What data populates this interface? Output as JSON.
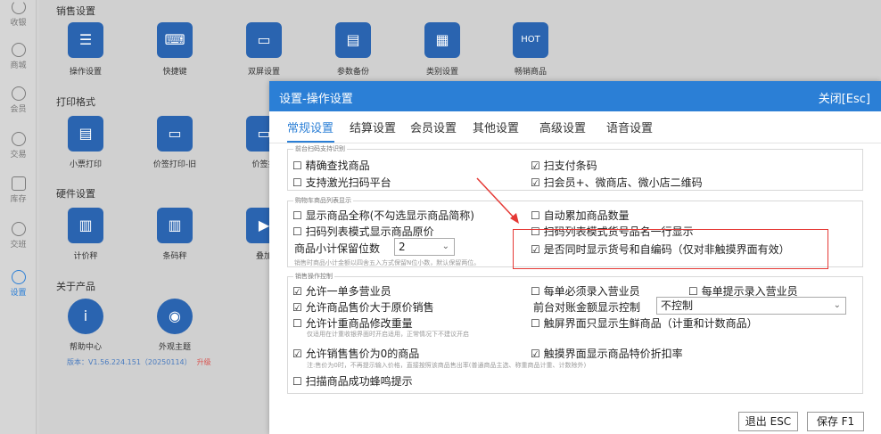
{
  "nav": [
    {
      "label": "收银",
      "icon": "cash-register-icon"
    },
    {
      "label": "商城",
      "icon": "store-icon"
    },
    {
      "label": "会员",
      "icon": "member-icon"
    },
    {
      "label": "交易",
      "icon": "yen-icon"
    },
    {
      "label": "库存",
      "icon": "inventory-icon"
    },
    {
      "label": "交班",
      "icon": "shift-icon"
    },
    {
      "label": "设置",
      "icon": "gear-icon"
    }
  ],
  "bg": {
    "sections": {
      "sales": "销售设置",
      "print": "打印格式",
      "hardware": "硬件设置",
      "about": "关于产品"
    },
    "tiles": [
      {
        "label": "操作设置",
        "glyph": "☰"
      },
      {
        "label": "快捷键",
        "glyph": "⌨"
      },
      {
        "label": "双屏设置",
        "glyph": "▭"
      },
      {
        "label": "参数备份",
        "glyph": "▤"
      },
      {
        "label": "类别设置",
        "glyph": "▦"
      },
      {
        "label": "畅销商品",
        "glyph": "HOT"
      },
      {
        "label": "小票打印",
        "glyph": "▤"
      },
      {
        "label": "价签打印-旧",
        "glyph": "▭"
      },
      {
        "label": "价签打",
        "glyph": "▭"
      },
      {
        "label": "计价秤",
        "glyph": "▥"
      },
      {
        "label": "条码秤",
        "glyph": "▥"
      },
      {
        "label": "叠加",
        "glyph": "▶"
      },
      {
        "label": "帮助中心",
        "glyph": "i"
      },
      {
        "label": "外观主题",
        "glyph": "◉"
      }
    ],
    "version": "版本：V1.56.224.151（20250114）",
    "upgrade": "升级"
  },
  "modal": {
    "title": "设置-操作设置",
    "close": "关闭[Esc]",
    "tabs": [
      "常规设置",
      "结算设置",
      "会员设置",
      "其他设置",
      "高级设置",
      "语音设置"
    ],
    "group1": {
      "title": "前台扫码支持识别",
      "opts": [
        {
          "label": "精确查找商品",
          "checked": false
        },
        {
          "label": "支持激光扫码平台",
          "checked": false
        },
        {
          "label": "扫支付条码",
          "checked": true
        },
        {
          "label": "扫会员+、微商店、微小店二维码",
          "checked": true
        }
      ]
    },
    "group2": {
      "title": "购物车商品列表显示",
      "opts": [
        {
          "label": "显示商品全称(不勾选显示商品简称)",
          "checked": false
        },
        {
          "label": "扫码列表模式显示商品原价",
          "checked": false
        },
        {
          "label": "自动累加商品数量",
          "checked": false
        },
        {
          "label": "扫码列表模式货号品名一行显示",
          "checked": false
        },
        {
          "label": "是否同时显示货号和自编码（仅对非触摸界面有效）",
          "checked": true
        }
      ],
      "decimal_label": "商品小计保留位数",
      "decimal_value": "2",
      "hint": "销售时商品小计金额以四舍五入方式保留N位小数，默认保留两位。"
    },
    "group3": {
      "title": "销售操作控制",
      "opts": [
        {
          "label": "允许一单多营业员",
          "checked": true
        },
        {
          "label": "允许商品售价大于原价销售",
          "checked": true
        },
        {
          "label": "允许计重商品修改重量",
          "checked": false
        },
        {
          "label": "允许销售售价为0的商品",
          "checked": true
        },
        {
          "label": "扫描商品成功蜂鸣提示",
          "checked": false
        },
        {
          "label": "每单必须录入营业员",
          "checked": false
        },
        {
          "label": "每单提示录入营业员",
          "checked": false
        },
        {
          "label": "触屏界面只显示生鲜商品（计重和计数商品）",
          "checked": false
        },
        {
          "label": "触摸界面显示商品特价折扣率",
          "checked": true
        }
      ],
      "amount_label": "前台对账金额显示控制",
      "amount_value": "不控制",
      "hint_weight": "仅适用在计重收银界面时开启适用，正常情况下不建议开启",
      "hint_zero": "注:售价为0时，不再提示输入价格，直接按照该商品售出率(普通商品主选、称重商品计重、计数除外)"
    },
    "buttons": {
      "exit": "退出 ESC",
      "save": "保存 F1"
    }
  }
}
